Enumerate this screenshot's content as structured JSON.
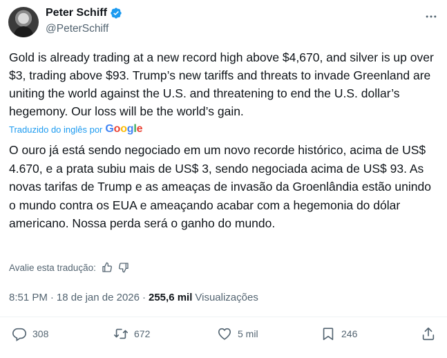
{
  "author": {
    "name": "Peter Schiff",
    "handle": "@PeterSchiff"
  },
  "tweet": {
    "text": "Gold is already trading at a new record high above $4,670, and silver is up over $3, trading above $93. Trump’s new tariffs and threats to invade Greenland are uniting the world against the U.S. and threatening to end the U.S. dollar’s hegemony. Our loss will be the world’s gain."
  },
  "translation": {
    "label": "Traduzido do inglês por",
    "provider": "Google",
    "text": "O ouro já está sendo negociado em um novo recorde histórico, acima de US$ 4.670, e a prata subiu mais de US$ 3, sendo negociada acima de US$ 93. As novas tarifas de Trump e as ameaças de invasão da Groenlândia estão unindo o mundo contra os EUA e ameaçando acabar com a hegemonia do dólar americano. Nossa perda será o ganho do mundo.",
    "rate_label": "Avalie esta tradução:"
  },
  "meta": {
    "time": "8:51 PM",
    "separator": "·",
    "date": "18 de jan de 2026",
    "views_count": "255,6 mil",
    "views_label": "Visualizações"
  },
  "actions": {
    "replies": "308",
    "reposts": "672",
    "likes": "5 mil",
    "bookmarks": "246"
  },
  "colors": {
    "accent": "#1d9bf0",
    "secondary_text": "#536471",
    "primary_text": "#0f1419"
  },
  "icons": [
    "verified-badge-icon",
    "more-icon",
    "thumbs-up-icon",
    "thumbs-down-icon",
    "reply-icon",
    "repost-icon",
    "like-icon",
    "bookmark-icon",
    "share-icon"
  ]
}
